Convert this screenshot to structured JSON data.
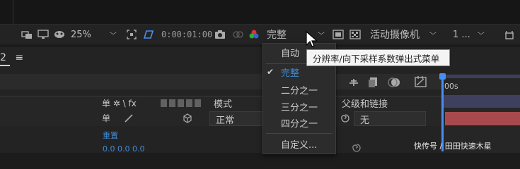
{
  "toolbar": {
    "zoom_value": "25%",
    "timecode": "0:00:01:00",
    "quality_value": "完整",
    "camera_value": "活动摄像机",
    "views_value": "1 ..."
  },
  "panel": {
    "tab_number": "2",
    "tab_menu_icon": "≡"
  },
  "layer_columns": {
    "switches_header": "单 ✲ \\ fx",
    "mode_header": "模式",
    "parent_header": "父级和链接",
    "row1_switch": "单",
    "row1_mode": "正常",
    "row1_parent": "无",
    "row2_label": "重置",
    "row3_values": "0.0  0.0  0.0"
  },
  "timeline": {
    "ruler_label": "00s"
  },
  "quality_menu": {
    "items": [
      {
        "label": "自动",
        "selected": false
      },
      {
        "label": "完整",
        "selected": true
      },
      {
        "label": "二分之一",
        "selected": false
      },
      {
        "label": "三分之一",
        "selected": false
      },
      {
        "label": "四分之一",
        "selected": false
      },
      {
        "label": "自定义...",
        "selected": false
      }
    ]
  },
  "tooltip": {
    "text": "分辨率/向下采样系数弹出式菜单"
  },
  "watermark": {
    "text": "快传号 / 田田快速木星"
  },
  "colors": {
    "accent_blue": "#3f8bd6",
    "playhead": "#4b8ef0",
    "layer_bar_red": "#a8494d"
  }
}
